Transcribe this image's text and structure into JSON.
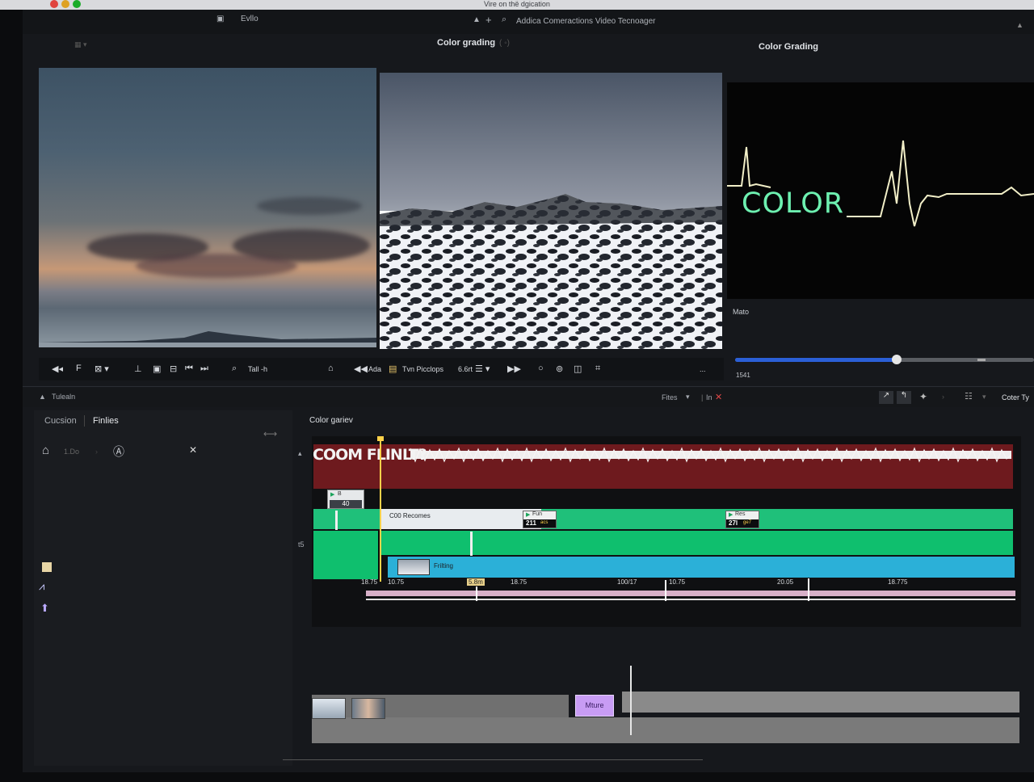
{
  "window": {
    "os_title": "Vire on thë dgication",
    "project_name": "Evllo",
    "center_title": "Addica Comeractions Video Tecnoager"
  },
  "headers": {
    "viewer_title": "Color grading",
    "grading_title": "Color Grading"
  },
  "grading_panel": {
    "overlay_text": "COLOR",
    "label": "Mato",
    "slider_value_text": "1541",
    "slider_level": 0.54,
    "accent_color": "#2b5fd6"
  },
  "toolbar": {
    "search_label": "Tall -h",
    "back_label": "Ada",
    "title_label": "Tvn Picclops",
    "rate_label": "6.6rt",
    "more_label": "..."
  },
  "panelbar": {
    "left_label": "Tulealn",
    "filter_label": "Fites",
    "in_label": "In",
    "right_label": "Coter Ty"
  },
  "left_panel": {
    "tabs": [
      "Cucsion",
      "Finlies"
    ],
    "item_label": "1.Do"
  },
  "timeline": {
    "label": "Color gariev",
    "audio_title": "COOM FLINLT?",
    "side_marker": "t5",
    "tag_top": {
      "header": "B",
      "value": "40"
    },
    "tag_fun": {
      "header": "Fun",
      "value": "211",
      "unit": "acs"
    },
    "tag_res": {
      "header": "Res",
      "value": "27l",
      "unit": "ge7"
    },
    "clip_green_label": "C00 Recomes",
    "clip_blue_label": "Frilting",
    "ruler_labels": [
      "18.75",
      "10.75",
      "5.8m",
      "18.75",
      "100/17",
      "10.75",
      "20.05",
      "18.775"
    ],
    "lower_clip_label": "Mture"
  }
}
